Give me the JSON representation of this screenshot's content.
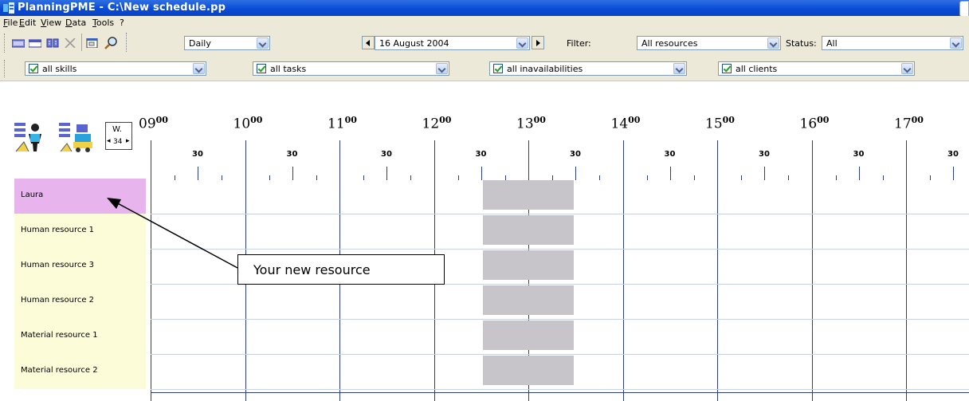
{
  "window": {
    "title": "PlanningPME - C:\\New schedule.pp"
  },
  "menu": [
    "File",
    "Edit",
    "View",
    "Data",
    "Tools",
    "?"
  ],
  "toolbar": {
    "view_mode": "Daily",
    "date": "16  August  2004",
    "filter_label": "Filter:",
    "filter_value": "All resources",
    "status_label": "Status:",
    "status_value": "All",
    "icons": [
      "calendar-month-icon",
      "calendar-icon",
      "add-task-icon",
      "delete-icon",
      "properties-icon",
      "find-icon"
    ]
  },
  "filters": {
    "skills": "all skills",
    "tasks": "all tasks",
    "inavailabilities": "all inavailabilities",
    "clients": "all clients"
  },
  "week": {
    "label": "W.",
    "number": "34"
  },
  "timeline": {
    "hours": [
      {
        "h": "09",
        "m": "00"
      },
      {
        "h": "10",
        "m": "00"
      },
      {
        "h": "11",
        "m": "00"
      },
      {
        "h": "12",
        "m": "00"
      },
      {
        "h": "13",
        "m": "00"
      },
      {
        "h": "14",
        "m": "00"
      },
      {
        "h": "15",
        "m": "00"
      },
      {
        "h": "16",
        "m": "00"
      },
      {
        "h": "17",
        "m": "00"
      }
    ],
    "half_label": "30"
  },
  "resources": [
    {
      "name": "Laura",
      "selected": true
    },
    {
      "name": "Human resource 1",
      "selected": false
    },
    {
      "name": "Human resource 3",
      "selected": false
    },
    {
      "name": "Human resource 2",
      "selected": false
    },
    {
      "name": "Material resource 1",
      "selected": false
    },
    {
      "name": "Material resource 2",
      "selected": false
    }
  ],
  "callout": {
    "text": "Your new resource"
  },
  "colors": {
    "selected_resource": "#e7b4ee",
    "resource_bg": "#fcfcd9",
    "block": "#c7c5c9",
    "grid": "#2c3d8a"
  }
}
